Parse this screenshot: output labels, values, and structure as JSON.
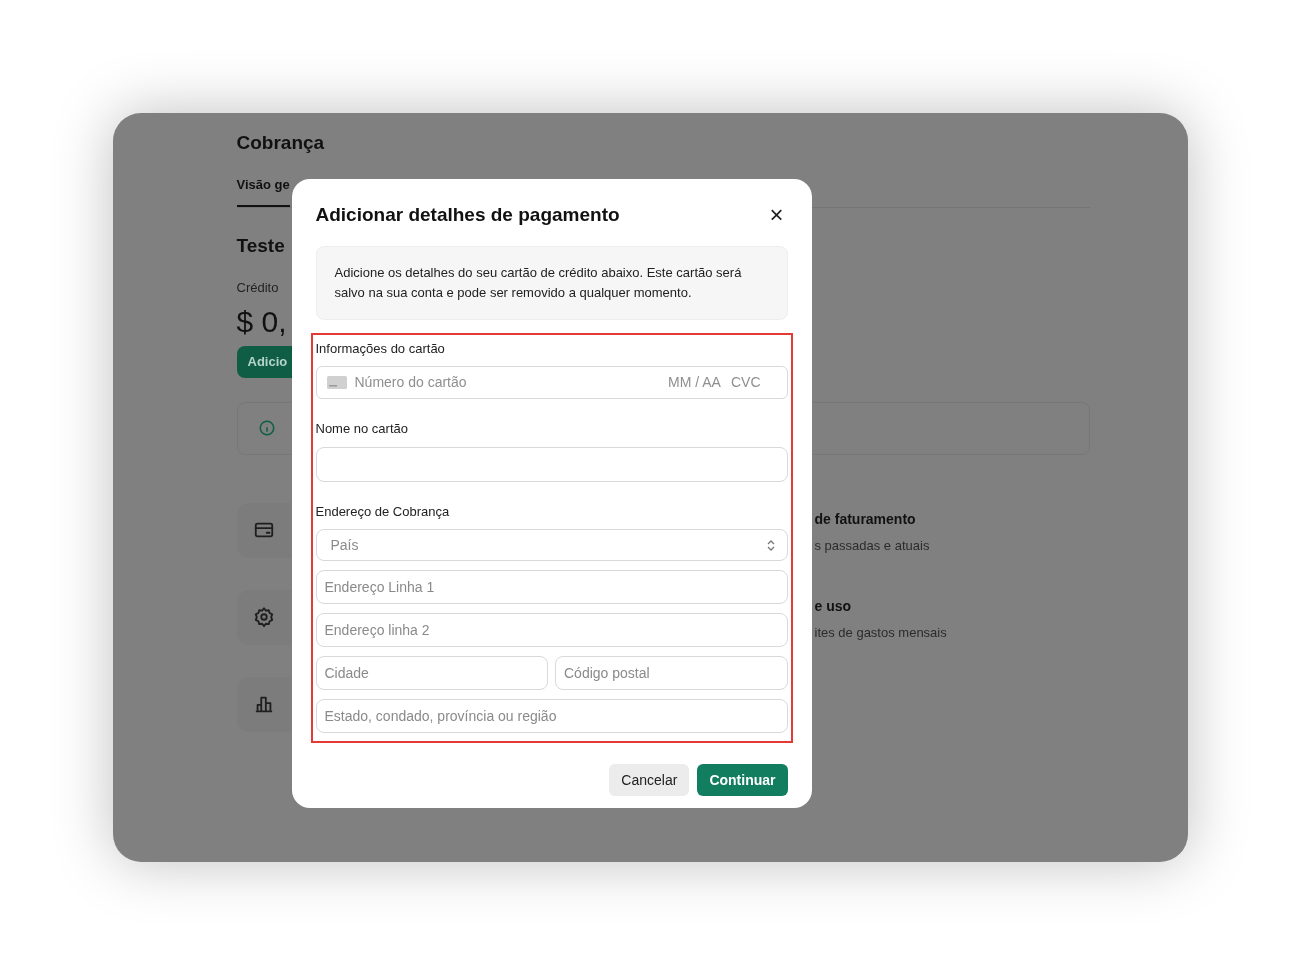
{
  "page": {
    "title": "Cobrança",
    "tabs": [
      {
        "label": "Visão ge",
        "selected": true
      }
    ],
    "section_title": "Teste",
    "credit_label": "Crédito",
    "credit_amount": "$ 0,",
    "add_button": "Adicio",
    "options": [
      {
        "kind": "card",
        "title": "de faturamento",
        "subtitle": "s passadas e atuais"
      },
      {
        "kind": "gear",
        "title": "e uso",
        "subtitle": "ites de gastos mensais"
      },
      {
        "kind": "chart"
      }
    ]
  },
  "dialog": {
    "title": "Adicionar detalhes de pagamento",
    "close": "×",
    "notice": "Adicione os detalhes do seu cartão de crédito abaixo. Este cartão será salvo na sua conta e pode ser removido a qualquer momento.",
    "card_section": {
      "label": "Informações do cartão",
      "number_placeholder": "Número do cartão",
      "expiry_placeholder": "MM / AA",
      "cvc_placeholder": "CVC"
    },
    "name_section": {
      "label": "Nome no cartão"
    },
    "address_section": {
      "label": "Endereço de Cobrança",
      "country_placeholder": "País",
      "line1_placeholder": "Endereço Linha 1",
      "line2_placeholder": "Endereço linha 2",
      "city_placeholder": "Cidade",
      "postal_placeholder": "Código postal",
      "region_placeholder": "Estado, condado, província ou região"
    },
    "buttons": [
      {
        "kind": "secondary",
        "label": "Cancelar"
      },
      {
        "kind": "primary",
        "label": "Continuar"
      }
    ]
  }
}
